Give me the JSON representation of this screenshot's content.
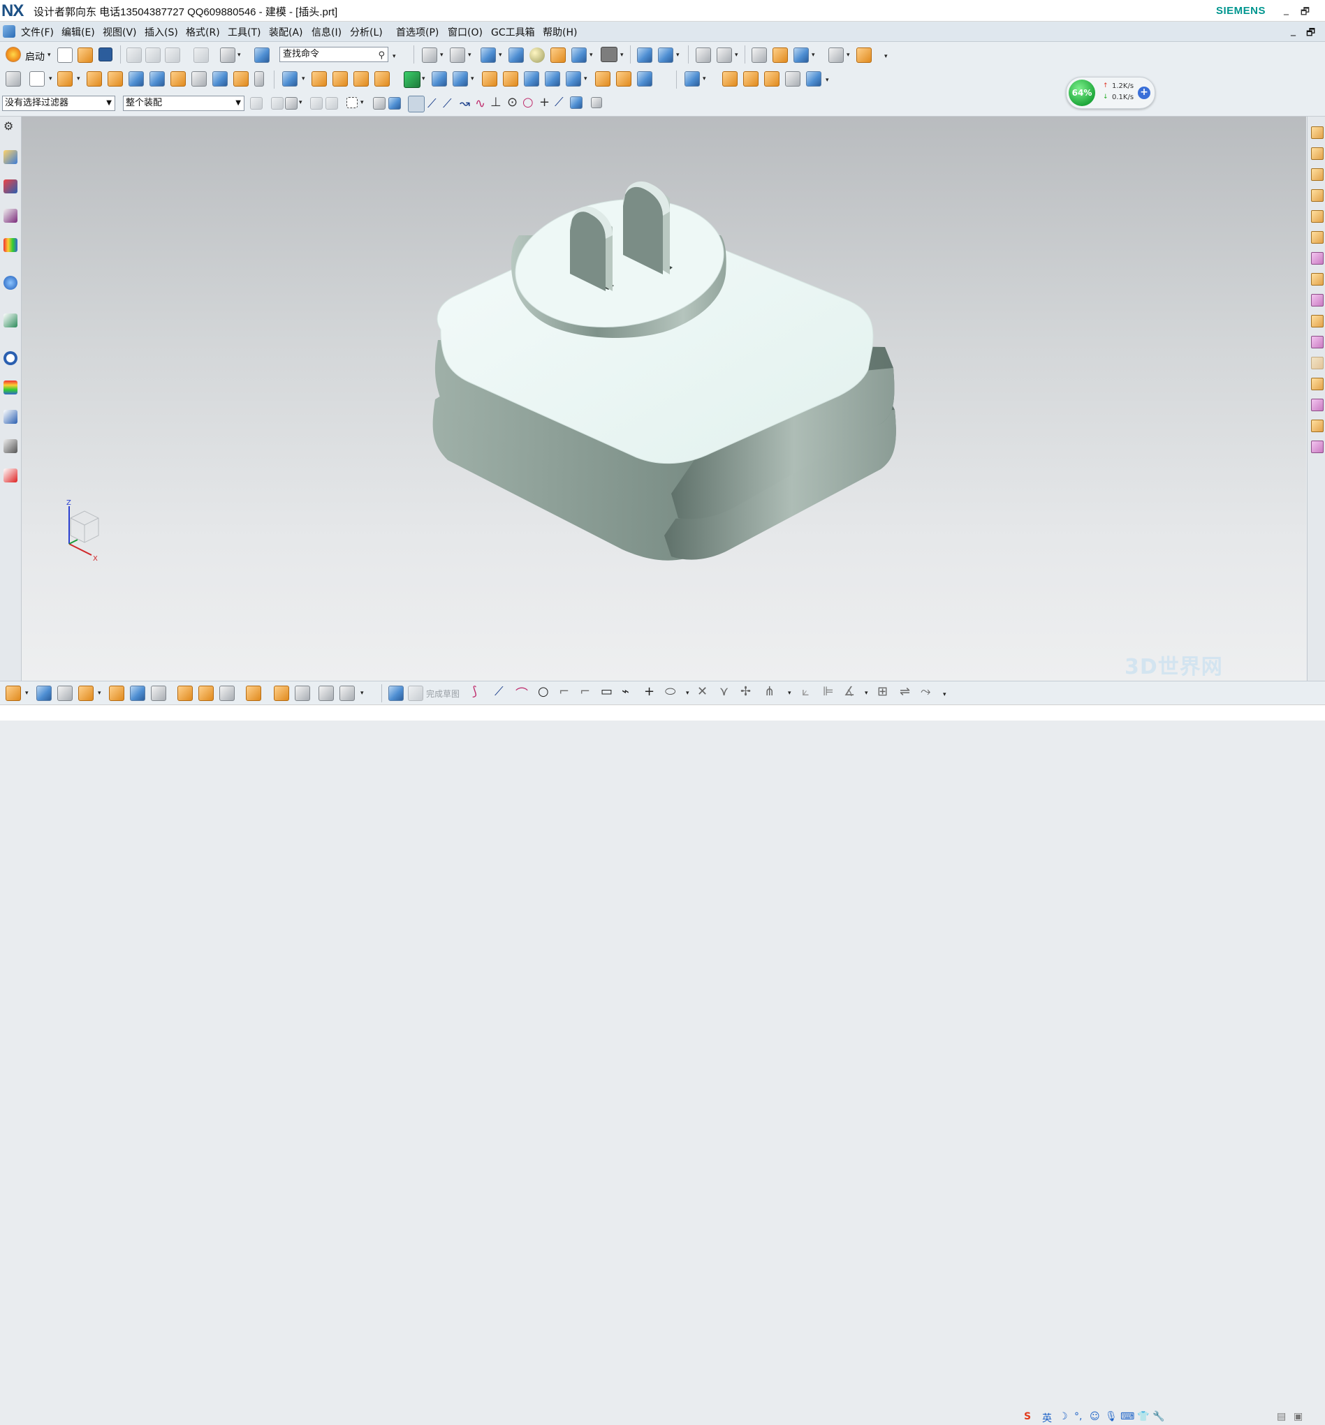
{
  "window": {
    "logo": "NX",
    "title": "设计者郭向东  电话13504387727  QQ609880546 - 建模 - [插头.prt]",
    "brand": "SIEMENS",
    "minimize": "_",
    "restore": "🗗"
  },
  "menu": {
    "items": [
      "文件(F)",
      "编辑(E)",
      "视图(V)",
      "插入(S)",
      "格式(R)",
      "工具(T)",
      "装配(A)",
      "信息(I)",
      "分析(L)",
      "首选项(P)",
      "窗口(O)",
      "GC工具箱",
      "帮助(H)"
    ]
  },
  "toolbar": {
    "start_label": "启动",
    "search_value": "查找命令",
    "selection_filter": "没有选择过滤器",
    "assembly_scope": "整个装配",
    "finish_sketch": "完成草图"
  },
  "netmon": {
    "percent": "64%",
    "upload": "1.2K/s",
    "download": "0.1K/s"
  },
  "status": {
    "ime_lang": "英"
  },
  "watermark": "3D世界网",
  "axes": {
    "z": "Z",
    "x": "X"
  },
  "colors": {
    "titlebar_bg": "#ffffff",
    "menubar_bg": "#dfe7ee",
    "toolbar_bg": "#e9eef2",
    "siemens_teal": "#00968f",
    "model_top": "#eef8f6",
    "model_side": "#8fa39a",
    "netmon_green": "#1fa83b"
  }
}
